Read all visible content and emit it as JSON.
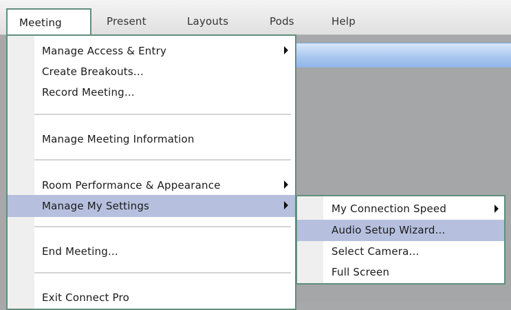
{
  "menubar": {
    "items": [
      {
        "label": "Meeting"
      },
      {
        "label": "Present"
      },
      {
        "label": "Layouts"
      },
      {
        "label": "Pods"
      },
      {
        "label": "Help"
      }
    ]
  },
  "meeting_menu": {
    "items": [
      {
        "label": "Manage Access & Entry",
        "has_submenu": true
      },
      {
        "label": "Create Breakouts..."
      },
      {
        "label": "Record Meeting..."
      },
      {
        "label": "Manage Meeting Information"
      },
      {
        "label": "Room Performance & Appearance",
        "has_submenu": true
      },
      {
        "label": "Manage My Settings",
        "has_submenu": true,
        "highlighted": true
      },
      {
        "label": "End Meeting..."
      },
      {
        "label": "Exit Connect Pro"
      }
    ]
  },
  "settings_submenu": {
    "items": [
      {
        "label": "My Connection Speed",
        "has_submenu": true
      },
      {
        "label": "Audio Setup Wizard...",
        "highlighted": true
      },
      {
        "label": "Select Camera..."
      },
      {
        "label": "Full Screen"
      }
    ]
  },
  "colors": {
    "highlight": "#b6c0de",
    "menu_border": "#5f8f7c",
    "room_bar": "#aac8f1",
    "background": "#a6a8a9"
  }
}
